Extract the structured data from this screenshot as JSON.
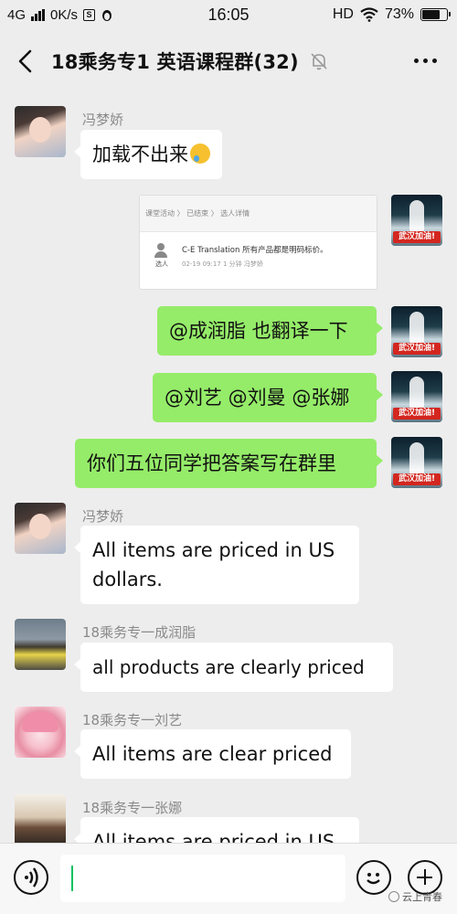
{
  "status_bar": {
    "network": "4G",
    "speed": "0K/s",
    "time": "16:05",
    "hd": "HD",
    "battery_level": "73%",
    "battery_fraction": 0.73
  },
  "header": {
    "title": "18乘务专1 英语课程群(32)",
    "icons": [
      "back-arrow-icon",
      "mute-bell-icon",
      "more-icon"
    ]
  },
  "messages": [
    {
      "sender": "冯梦娇",
      "side": "left",
      "text": "加载不出来",
      "emoji": "sweat-laugh"
    },
    {
      "side": "right",
      "type": "image",
      "image": {
        "crumbs": "课堂活动 〉 已结束 〉 选人详情",
        "label": "选人",
        "text": "C-E Translation 所有产品都是明码标价。",
        "meta": "02-19 09:17    1 分钟    冯梦娇"
      }
    },
    {
      "side": "right",
      "text": "@成润脂 也翻译一下"
    },
    {
      "side": "right",
      "text": "@刘艺 @刘曼 @张娜"
    },
    {
      "side": "right",
      "text": "你们五位同学把答案写在群里"
    },
    {
      "sender": "冯梦娇",
      "side": "left",
      "text_lines": [
        "All items are priced in US",
        "dollars."
      ]
    },
    {
      "sender": "18乘务专一成润脂",
      "side": "left",
      "text": "all products are clearly priced"
    },
    {
      "sender": "18乘务专一刘艺",
      "side": "left",
      "text": "All items are clear priced"
    },
    {
      "sender": "18乘务专一张娜",
      "side": "left",
      "text": "All items are priced in US"
    }
  ],
  "avatar_badge": "武汉加油!",
  "input_bar": {
    "watermark": "云上青春",
    "icons": [
      "voice-icon",
      "emoji-icon",
      "plus-icon"
    ]
  },
  "colors": {
    "background": "#ededed",
    "my_bubble": "#95ec69",
    "other_bubble": "#ffffff",
    "cursor": "#07c160",
    "badge": "#d3261f"
  }
}
